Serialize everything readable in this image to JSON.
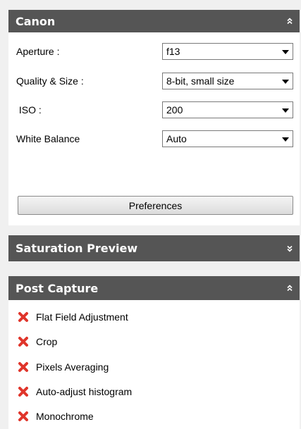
{
  "colors": {
    "header_bg": "#555555",
    "header_text": "#ffffff",
    "panel_bg": "#ffffff",
    "page_bg": "#f0f0f0",
    "remove_icon": "#e0352b"
  },
  "canon": {
    "title": "Canon",
    "collapse_icon": "chevron-double-up-icon",
    "settings": [
      {
        "label": "Aperture :",
        "value": "f13"
      },
      {
        "label": "Quality & Size :",
        "value": "8-bit, small size"
      },
      {
        "label": " ISO :",
        "value": "200"
      },
      {
        "label": "White Balance",
        "value": "Auto"
      }
    ],
    "preferences_label": "Preferences"
  },
  "saturation": {
    "title": "Saturation Preview",
    "expand_icon": "chevron-double-down-icon"
  },
  "post_capture": {
    "title": "Post Capture",
    "collapse_icon": "chevron-double-up-icon",
    "item_icon": "red-x-icon",
    "items": [
      {
        "label": "Flat Field Adjustment"
      },
      {
        "label": "Crop"
      },
      {
        "label": "Pixels Averaging"
      },
      {
        "label": "Auto-adjust histogram"
      },
      {
        "label": "Monochrome"
      }
    ]
  }
}
